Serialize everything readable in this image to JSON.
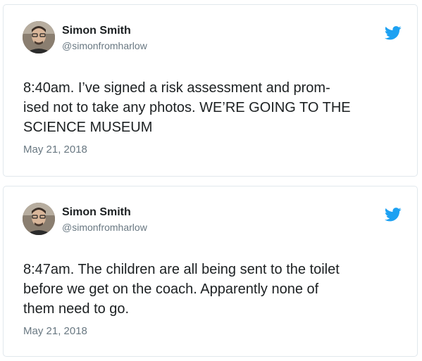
{
  "tweets": [
    {
      "author_name": "Simon Smith",
      "author_handle": "@simonfromharlow",
      "text": "8:40am. I’ve signed a risk assessment and prom-\nised not to take any photos. WE’RE GOING TO THE\nSCIENCE MUSEUM",
      "date": "May 21, 2018",
      "avatar_icon": "user-avatar-photo",
      "brand_icon": "twitter-bird-icon"
    },
    {
      "author_name": "Simon Smith",
      "author_handle": "@simonfromharlow",
      "text": "8:47am. The children are all being sent to the toilet\nbefore we get on the coach. Apparently none of\nthem need to go.",
      "date": "May 21, 2018",
      "avatar_icon": "user-avatar-photo",
      "brand_icon": "twitter-bird-icon"
    }
  ],
  "colors": {
    "twitter_blue": "#1da1f2",
    "text_primary": "#1c2022",
    "text_secondary": "#697882",
    "card_border": "#e1e8ed"
  }
}
